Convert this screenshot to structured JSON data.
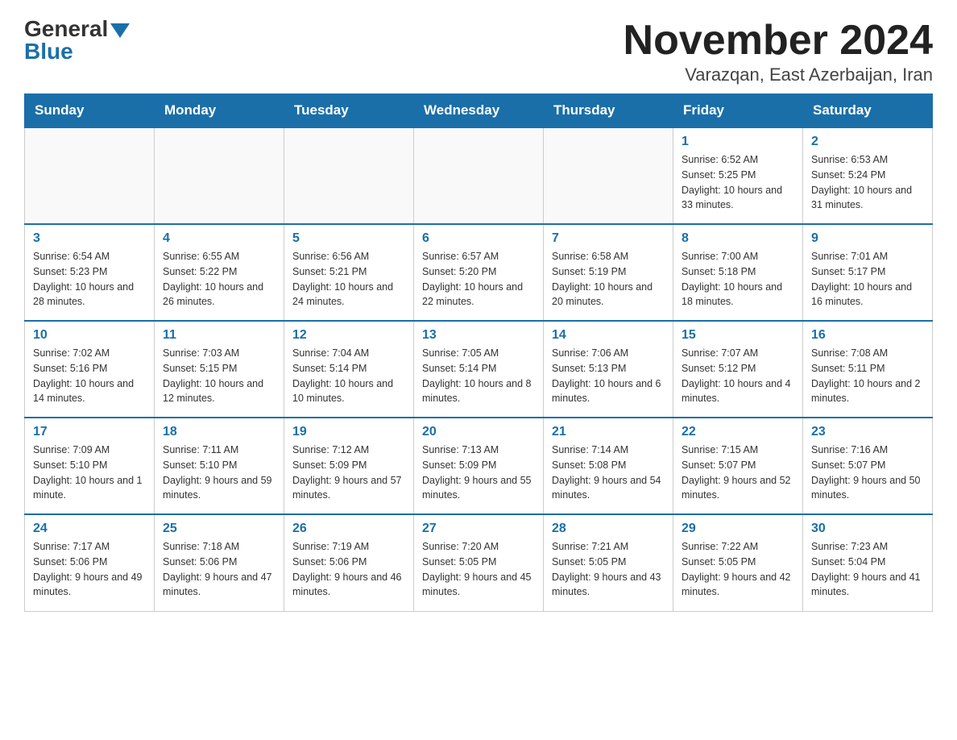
{
  "header": {
    "logo_general": "General",
    "logo_blue": "Blue",
    "title": "November 2024",
    "subtitle": "Varazqan, East Azerbaijan, Iran"
  },
  "calendar": {
    "days_of_week": [
      "Sunday",
      "Monday",
      "Tuesday",
      "Wednesday",
      "Thursday",
      "Friday",
      "Saturday"
    ],
    "weeks": [
      [
        {
          "day": "",
          "info": ""
        },
        {
          "day": "",
          "info": ""
        },
        {
          "day": "",
          "info": ""
        },
        {
          "day": "",
          "info": ""
        },
        {
          "day": "",
          "info": ""
        },
        {
          "day": "1",
          "info": "Sunrise: 6:52 AM\nSunset: 5:25 PM\nDaylight: 10 hours and 33 minutes."
        },
        {
          "day": "2",
          "info": "Sunrise: 6:53 AM\nSunset: 5:24 PM\nDaylight: 10 hours and 31 minutes."
        }
      ],
      [
        {
          "day": "3",
          "info": "Sunrise: 6:54 AM\nSunset: 5:23 PM\nDaylight: 10 hours and 28 minutes."
        },
        {
          "day": "4",
          "info": "Sunrise: 6:55 AM\nSunset: 5:22 PM\nDaylight: 10 hours and 26 minutes."
        },
        {
          "day": "5",
          "info": "Sunrise: 6:56 AM\nSunset: 5:21 PM\nDaylight: 10 hours and 24 minutes."
        },
        {
          "day": "6",
          "info": "Sunrise: 6:57 AM\nSunset: 5:20 PM\nDaylight: 10 hours and 22 minutes."
        },
        {
          "day": "7",
          "info": "Sunrise: 6:58 AM\nSunset: 5:19 PM\nDaylight: 10 hours and 20 minutes."
        },
        {
          "day": "8",
          "info": "Sunrise: 7:00 AM\nSunset: 5:18 PM\nDaylight: 10 hours and 18 minutes."
        },
        {
          "day": "9",
          "info": "Sunrise: 7:01 AM\nSunset: 5:17 PM\nDaylight: 10 hours and 16 minutes."
        }
      ],
      [
        {
          "day": "10",
          "info": "Sunrise: 7:02 AM\nSunset: 5:16 PM\nDaylight: 10 hours and 14 minutes."
        },
        {
          "day": "11",
          "info": "Sunrise: 7:03 AM\nSunset: 5:15 PM\nDaylight: 10 hours and 12 minutes."
        },
        {
          "day": "12",
          "info": "Sunrise: 7:04 AM\nSunset: 5:14 PM\nDaylight: 10 hours and 10 minutes."
        },
        {
          "day": "13",
          "info": "Sunrise: 7:05 AM\nSunset: 5:14 PM\nDaylight: 10 hours and 8 minutes."
        },
        {
          "day": "14",
          "info": "Sunrise: 7:06 AM\nSunset: 5:13 PM\nDaylight: 10 hours and 6 minutes."
        },
        {
          "day": "15",
          "info": "Sunrise: 7:07 AM\nSunset: 5:12 PM\nDaylight: 10 hours and 4 minutes."
        },
        {
          "day": "16",
          "info": "Sunrise: 7:08 AM\nSunset: 5:11 PM\nDaylight: 10 hours and 2 minutes."
        }
      ],
      [
        {
          "day": "17",
          "info": "Sunrise: 7:09 AM\nSunset: 5:10 PM\nDaylight: 10 hours and 1 minute."
        },
        {
          "day": "18",
          "info": "Sunrise: 7:11 AM\nSunset: 5:10 PM\nDaylight: 9 hours and 59 minutes."
        },
        {
          "day": "19",
          "info": "Sunrise: 7:12 AM\nSunset: 5:09 PM\nDaylight: 9 hours and 57 minutes."
        },
        {
          "day": "20",
          "info": "Sunrise: 7:13 AM\nSunset: 5:09 PM\nDaylight: 9 hours and 55 minutes."
        },
        {
          "day": "21",
          "info": "Sunrise: 7:14 AM\nSunset: 5:08 PM\nDaylight: 9 hours and 54 minutes."
        },
        {
          "day": "22",
          "info": "Sunrise: 7:15 AM\nSunset: 5:07 PM\nDaylight: 9 hours and 52 minutes."
        },
        {
          "day": "23",
          "info": "Sunrise: 7:16 AM\nSunset: 5:07 PM\nDaylight: 9 hours and 50 minutes."
        }
      ],
      [
        {
          "day": "24",
          "info": "Sunrise: 7:17 AM\nSunset: 5:06 PM\nDaylight: 9 hours and 49 minutes."
        },
        {
          "day": "25",
          "info": "Sunrise: 7:18 AM\nSunset: 5:06 PM\nDaylight: 9 hours and 47 minutes."
        },
        {
          "day": "26",
          "info": "Sunrise: 7:19 AM\nSunset: 5:06 PM\nDaylight: 9 hours and 46 minutes."
        },
        {
          "day": "27",
          "info": "Sunrise: 7:20 AM\nSunset: 5:05 PM\nDaylight: 9 hours and 45 minutes."
        },
        {
          "day": "28",
          "info": "Sunrise: 7:21 AM\nSunset: 5:05 PM\nDaylight: 9 hours and 43 minutes."
        },
        {
          "day": "29",
          "info": "Sunrise: 7:22 AM\nSunset: 5:05 PM\nDaylight: 9 hours and 42 minutes."
        },
        {
          "day": "30",
          "info": "Sunrise: 7:23 AM\nSunset: 5:04 PM\nDaylight: 9 hours and 41 minutes."
        }
      ]
    ]
  }
}
